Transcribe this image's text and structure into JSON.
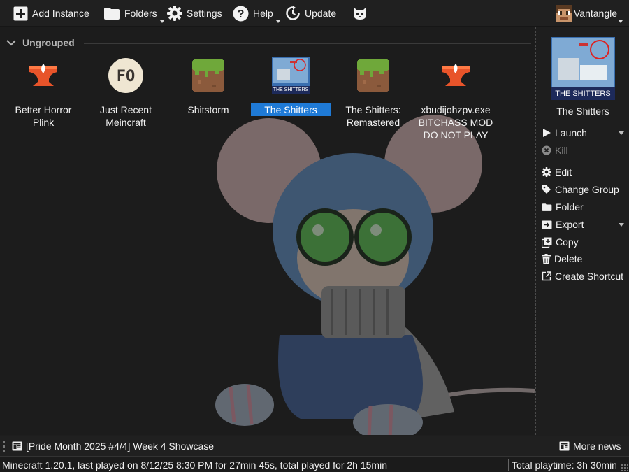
{
  "toolbar": {
    "add_instance": "Add Instance",
    "folders": "Folders",
    "settings": "Settings",
    "help": "Help",
    "update": "Update",
    "account_name": "Vantangle"
  },
  "group": {
    "name": "Ungrouped",
    "instances": [
      {
        "label": "Better Horror\nPlink",
        "icon": "anvil-icon",
        "selected": false
      },
      {
        "label": "Just Recent\nMeincraft",
        "icon": "fo-badge-icon",
        "selected": false
      },
      {
        "label": "Shitstorm",
        "icon": "grass-block-icon",
        "selected": false
      },
      {
        "label": "The Shitters",
        "icon": "custom-thumbnail-icon",
        "selected": true
      },
      {
        "label": "The Shitters:\nRemastered",
        "icon": "grass-block-icon",
        "selected": false
      },
      {
        "label": "xbudijohzpv.exe\nBITCHASS MOD\nDO NOT PLAY",
        "icon": "anvil-icon",
        "selected": false
      }
    ],
    "thumbnail_caption": "THE SHITTERS"
  },
  "sidebar": {
    "selected_title": "The Shitters",
    "thumb_caption": "THE SHITTERS",
    "actions": {
      "launch": "Launch",
      "kill": "Kill",
      "edit": "Edit",
      "change_group": "Change Group",
      "folder": "Folder",
      "export": "Export",
      "copy": "Copy",
      "delete": "Delete",
      "create_shortcut": "Create Shortcut"
    }
  },
  "news": {
    "headline": "[Pride Month 2025 #4/4] Week 4 Showcase",
    "more": "More news"
  },
  "status": {
    "instance_info": "Minecraft 1.20.1, last played on 8/12/25 8:30 PM for 27min 45s, total played for 2h 15min",
    "total_playtime": "Total playtime: 3h 30min"
  },
  "colors": {
    "accent": "#1f7ad6",
    "background": "#1c1c1c",
    "toolbar": "#202020"
  }
}
